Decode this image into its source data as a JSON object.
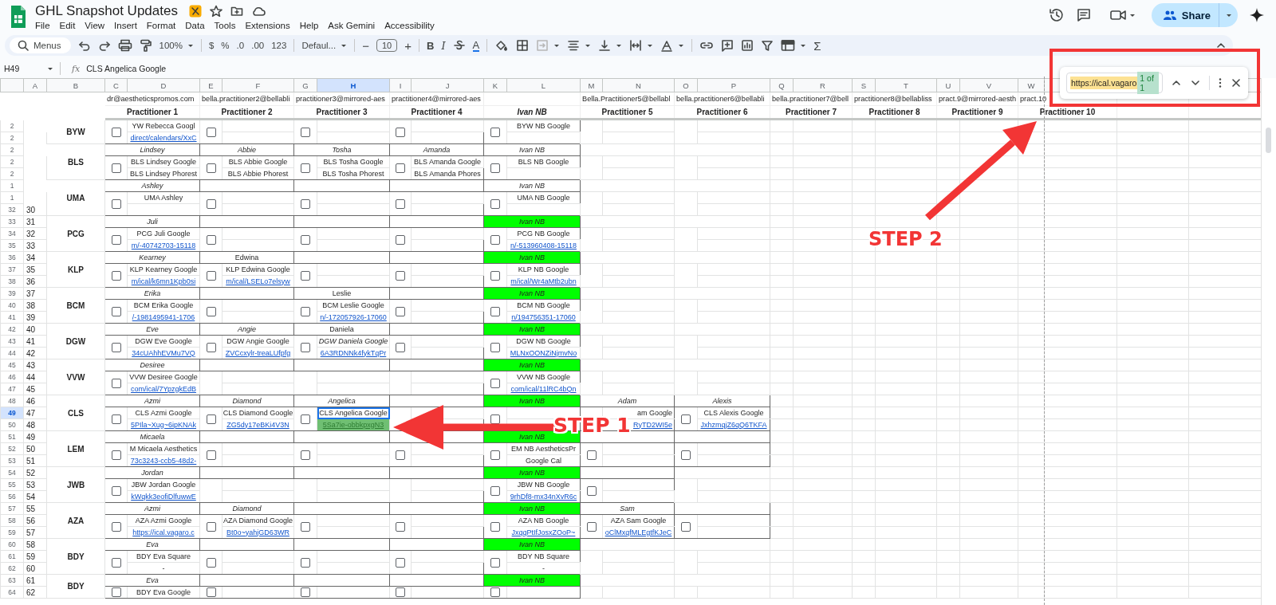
{
  "document": {
    "title": "GHL Snapshot Updates"
  },
  "menu": [
    "File",
    "Edit",
    "View",
    "Insert",
    "Format",
    "Data",
    "Tools",
    "Extensions",
    "Help",
    "Ask Gemini",
    "Accessibility"
  ],
  "share_button": "Share",
  "toolbar": {
    "search": "Menus",
    "zoom": "100%",
    "currency": "$",
    "percent": "%",
    "decrease_decimals": ".0",
    "increase_decimals": ".00",
    "number_format": "123",
    "font": "Defaul...",
    "minus": "−",
    "font_size": "10",
    "plus": "+",
    "bold": "B",
    "italic": "I",
    "text_color": "A",
    "functions": "Σ"
  },
  "formula_bar": {
    "name_box": "H49",
    "fx": "fx",
    "value": "CLS Angelica Google"
  },
  "find": {
    "query": "https://ical.vagaro",
    "count": "1 of 1"
  },
  "columns": [
    {
      "letter": "A",
      "selected": false
    },
    {
      "letter": "B",
      "selected": false
    },
    {
      "letter": "C",
      "selected": false
    },
    {
      "letter": "D",
      "selected": false
    },
    {
      "letter": "E",
      "selected": false
    },
    {
      "letter": "F",
      "selected": false
    },
    {
      "letter": "G",
      "selected": false
    },
    {
      "letter": "H",
      "selected": true
    },
    {
      "letter": "I",
      "selected": false
    },
    {
      "letter": "J",
      "selected": false
    },
    {
      "letter": "K",
      "selected": false
    },
    {
      "letter": "L",
      "selected": false
    },
    {
      "letter": "M",
      "selected": false
    },
    {
      "letter": "N",
      "selected": false
    },
    {
      "letter": "O",
      "selected": false
    },
    {
      "letter": "P",
      "selected": false
    },
    {
      "letter": "Q",
      "selected": false
    },
    {
      "letter": "R",
      "selected": false
    },
    {
      "letter": "S",
      "selected": false
    },
    {
      "letter": "T",
      "selected": false
    },
    {
      "letter": "U",
      "selected": false
    },
    {
      "letter": "V",
      "selected": false
    },
    {
      "letter": "W",
      "selected": false
    }
  ],
  "practitioner_columns": [
    {
      "email": "dr@aestheticspromos.com",
      "title": "Practitioner 1",
      "kind": "practitioner"
    },
    {
      "email": "bella.practitioner2@bellabli",
      "title": "Practitioner 2",
      "kind": "practitioner"
    },
    {
      "email": "practitioner3@mirrored-aes",
      "title": "Practitioner 3",
      "kind": "practitioner"
    },
    {
      "email": "practitioner4@mirrored-aes",
      "title": "Practitioner 4",
      "kind": "practitioner"
    },
    {
      "title": "Ivan NB",
      "kind": "house"
    },
    {
      "email": "Bella.Practitioner5@bellabl",
      "title": "Practitioner 5",
      "kind": "practitioner"
    },
    {
      "email": "bella.practitioner6@bellabli",
      "title": "Practitioner 6",
      "kind": "practitioner"
    },
    {
      "email": "bella.practitioner7@bell",
      "title": "Practitioner 7",
      "kind": "practitioner"
    },
    {
      "email": "practitioner8@bellabliss",
      "title": "Practitioner 8",
      "kind": "practitioner"
    },
    {
      "email": "pract.9@mirrored-aesth",
      "title": "Practitioner 9",
      "kind": "practitioner"
    },
    {
      "email": "pract.10",
      "title": "Practitioner 10",
      "kind": "practitioner"
    }
  ],
  "groups": [
    {
      "code": "BYW",
      "rows": [
        {
          "number": "2",
          "selected": false
        },
        {
          "number": "2",
          "selected": false
        }
      ],
      "slots": [
        {
          "kind": "assigned",
          "checkbox": {
            "checked": false
          },
          "lines": [
            {
              "text": "YW Rebecca Googl",
              "kind": "plain",
              "selected": false
            },
            {
              "text": "direct/calendars/XxC",
              "kind": "link",
              "selected": false
            }
          ]
        },
        {
          "kind": "vacant",
          "checkbox": {
            "checked": false
          }
        },
        {
          "kind": "vacant",
          "checkbox": {
            "checked": false
          }
        },
        {
          "kind": "vacant",
          "checkbox": {
            "checked": false
          }
        },
        {
          "kind": "assigned",
          "checkbox": {
            "checked": false
          },
          "lines": [
            {
              "text": "BYW NB Google",
              "kind": "plain",
              "selected": false
            }
          ]
        }
      ]
    },
    {
      "code": "BLS",
      "rows": [
        {
          "number": "2",
          "selected": false
        },
        {
          "number": "2",
          "selected": false
        },
        {
          "number": "2",
          "selected": false
        }
      ],
      "slots": [
        {
          "name": "Lindsey",
          "kind": "assigned",
          "highlighted": false,
          "checkbox": {
            "checked": false
          },
          "lines": [
            {
              "text": "BLS Lindsey Google",
              "kind": "plain",
              "selected": false
            },
            {
              "text": "BLS Lindsey Phorest",
              "kind": "plain",
              "selected": false
            }
          ]
        },
        {
          "name": "Abbie",
          "kind": "assigned",
          "highlighted": false,
          "checkbox": {
            "checked": false
          },
          "lines": [
            {
              "text": "BLS Abbie Google",
              "kind": "plain",
              "selected": false
            },
            {
              "text": "BLS Abbie Phorest",
              "kind": "plain",
              "selected": false
            }
          ]
        },
        {
          "name": "Tosha",
          "kind": "assigned",
          "highlighted": false,
          "checkbox": {
            "checked": false
          },
          "lines": [
            {
              "text": "BLS Tosha Google",
              "kind": "plain",
              "selected": false
            },
            {
              "text": "BLS Tosha Phorest",
              "kind": "plain",
              "selected": false
            }
          ]
        },
        {
          "name": "Amanda",
          "kind": "assigned",
          "highlighted": false,
          "checkbox": {
            "checked": false
          },
          "lines": [
            {
              "text": "BLS Amanda Google",
              "kind": "plain",
              "selected": false
            },
            {
              "text": "BLS Amanda Phores",
              "kind": "plain",
              "selected": false
            }
          ]
        },
        {
          "name": "Ivan NB",
          "kind": "assigned",
          "highlighted": false,
          "checkbox": {
            "checked": false
          },
          "lines": [
            {
              "text": "BLS NB Google",
              "kind": "plain",
              "selected": false
            }
          ]
        }
      ]
    },
    {
      "code": "UMA",
      "rows": [
        {
          "number": "1",
          "selected": false
        },
        {
          "number": "1",
          "selected": false
        },
        {
          "number": "32",
          "label": "30",
          "selected": false
        }
      ],
      "slots": [
        {
          "name": "Ashley",
          "kind": "assigned",
          "highlighted": false,
          "checkbox": {
            "checked": false
          },
          "lines": [
            {
              "text": "UMA Ashley",
              "kind": "plain",
              "selected": false
            }
          ]
        },
        {
          "kind": "vacant",
          "checkbox": {
            "checked": false
          }
        },
        {
          "kind": "vacant",
          "checkbox": {
            "checked": false
          }
        },
        {
          "kind": "vacant",
          "checkbox": {
            "checked": false
          }
        },
        {
          "name": "Ivan NB",
          "kind": "assigned",
          "highlighted": false,
          "checkbox": {
            "checked": false
          },
          "lines": [
            {
              "text": "UMA NB Google",
              "kind": "plain",
              "selected": false
            }
          ]
        }
      ]
    },
    {
      "code": "PCG",
      "rows": [
        {
          "number": "33",
          "label": "31",
          "selected": false
        },
        {
          "number": "34",
          "label": "32",
          "selected": false
        },
        {
          "number": "35",
          "label": "33",
          "selected": false
        }
      ],
      "slots": [
        {
          "name": "Juli",
          "kind": "assigned",
          "highlighted": false,
          "checkbox": {
            "checked": false
          },
          "lines": [
            {
              "text": "PCG Juli Google",
              "kind": "plain",
              "selected": false
            },
            {
              "text": "m/-40742703-15118",
              "kind": "link",
              "selected": false
            }
          ]
        },
        {
          "kind": "vacant",
          "checkbox": {
            "checked": false
          }
        },
        {
          "kind": "vacant",
          "checkbox": {
            "checked": false
          }
        },
        {
          "kind": "vacant",
          "checkbox": {
            "checked": false
          }
        },
        {
          "name": "Ivan NB",
          "kind": "assigned",
          "highlighted": true,
          "checkbox": {
            "checked": false
          },
          "lines": [
            {
              "text": "PCG NB Google",
              "kind": "plain",
              "selected": false
            },
            {
              "text": "n/-513960408-15118",
              "kind": "link",
              "selected": false
            }
          ]
        }
      ]
    },
    {
      "code": "KLP",
      "rows": [
        {
          "number": "36",
          "label": "34",
          "selected": false
        },
        {
          "number": "37",
          "label": "35",
          "selected": false
        },
        {
          "number": "38",
          "label": "36",
          "selected": false
        }
      ],
      "slots": [
        {
          "name": "Kearney",
          "kind": "assigned",
          "highlighted": false,
          "checkbox": {
            "checked": false
          },
          "lines": [
            {
              "text": "KLP Kearney Google",
              "kind": "plain",
              "selected": false
            },
            {
              "text": "m/ical/k6mn1Kpb0si",
              "kind": "link",
              "selected": false
            }
          ]
        },
        {
          "name": "Edwina",
          "kind": "added",
          "highlighted": false,
          "checkbox": {
            "checked": false
          },
          "lines": [
            {
              "text": "KLP Edwina Google",
              "kind": "plain",
              "selected": false
            },
            {
              "text": "m/ical/LSELo7elsyw",
              "kind": "link",
              "selected": false
            }
          ]
        },
        {
          "kind": "vacant",
          "checkbox": {
            "checked": false
          }
        },
        {
          "kind": "vacant",
          "checkbox": {
            "checked": false
          }
        },
        {
          "name": "Ivan NB",
          "kind": "assigned",
          "highlighted": true,
          "checkbox": {
            "checked": false
          },
          "lines": [
            {
              "text": "KLP NB Google",
              "kind": "plain",
              "selected": false
            },
            {
              "text": "m/ical/Wr4aMtb2ubn",
              "kind": "link",
              "selected": false
            }
          ]
        }
      ]
    },
    {
      "code": "BCM",
      "rows": [
        {
          "number": "39",
          "label": "37",
          "selected": false
        },
        {
          "number": "40",
          "label": "38",
          "selected": false
        },
        {
          "number": "41",
          "label": "39",
          "selected": false
        }
      ],
      "slots": [
        {
          "name": "Erika",
          "kind": "assigned",
          "highlighted": false,
          "checkbox": {
            "checked": false
          },
          "lines": [
            {
              "text": "BCM Erika Google",
              "kind": "plain",
              "selected": false
            },
            {
              "text": "/-1981495941-1706",
              "kind": "link",
              "selected": false
            }
          ]
        },
        {
          "kind": "vacant",
          "checkbox": {
            "checked": false
          }
        },
        {
          "name": "Leslie",
          "kind": "added",
          "highlighted": false,
          "checkbox": {
            "checked": false
          },
          "lines": [
            {
              "text": "BCM Leslie Google",
              "kind": "plain",
              "selected": false
            },
            {
              "text": "n/-172057926-17060",
              "kind": "link",
              "selected": false
            }
          ]
        },
        {
          "kind": "vacant",
          "checkbox": {
            "checked": false
          }
        },
        {
          "name": "Ivan NB",
          "kind": "assigned",
          "highlighted": true,
          "checkbox": {
            "checked": false
          },
          "lines": [
            {
              "text": "BCM NB Google",
              "kind": "plain",
              "selected": false
            },
            {
              "text": "n/194756351-17060",
              "kind": "link",
              "selected": false
            }
          ]
        }
      ]
    },
    {
      "code": "DGW",
      "rows": [
        {
          "number": "42",
          "label": "40",
          "selected": false
        },
        {
          "number": "43",
          "label": "41",
          "selected": false
        },
        {
          "number": "44",
          "label": "42",
          "selected": false
        }
      ],
      "slots": [
        {
          "name": "Eve",
          "kind": "assigned",
          "highlighted": false,
          "checkbox": {
            "checked": false
          },
          "lines": [
            {
              "text": "DGW Eve Google",
              "kind": "plain",
              "selected": false
            },
            {
              "text": "34cUAhhEVMu7VQ",
              "kind": "link",
              "selected": false
            }
          ]
        },
        {
          "name": "Angie",
          "kind": "assigned",
          "highlighted": false,
          "checkbox": {
            "checked": false
          },
          "lines": [
            {
              "text": "DGW Angie Google",
              "kind": "plain",
              "selected": false
            },
            {
              "text": "ZVCcxylr-treaLUfpfg",
              "kind": "link",
              "selected": false
            }
          ]
        },
        {
          "name": "Daniela",
          "kind": "added",
          "highlighted": false,
          "checkbox": {
            "checked": false
          },
          "lines": [
            {
              "text": "DGW Daniela Google",
              "kind": "italic",
              "selected": false
            },
            {
              "text": "6A3RDNNk4fykTqPr",
              "kind": "link",
              "selected": false
            }
          ]
        },
        {
          "kind": "vacant",
          "checkbox": {
            "checked": false
          }
        },
        {
          "name": "Ivan NB",
          "kind": "assigned",
          "highlighted": true,
          "checkbox": {
            "checked": false
          },
          "lines": [
            {
              "text": "DGW NB Google",
              "kind": "plain",
              "selected": false
            },
            {
              "text": "MLNxOONZiNjmvNo",
              "kind": "link",
              "selected": false
            }
          ]
        }
      ]
    },
    {
      "code": "VVW",
      "rows": [
        {
          "number": "45",
          "label": "43",
          "selected": false
        },
        {
          "number": "46",
          "label": "44",
          "selected": false
        },
        {
          "number": "47",
          "label": "45",
          "selected": false
        }
      ],
      "slots": [
        {
          "name": "Desiree",
          "kind": "assigned",
          "highlighted": false,
          "checkbox": {
            "checked": false
          },
          "lines": [
            {
              "text": "VVW Desiree Google",
              "kind": "plain",
              "selected": false
            },
            {
              "text": "com/ical/7YpzgkEdB",
              "kind": "link",
              "selected": false
            }
          ]
        },
        {
          "kind": "vacant"
        },
        {
          "kind": "vacant"
        },
        {
          "kind": "vacant"
        },
        {
          "name": "Ivan NB",
          "kind": "assigned",
          "highlighted": true,
          "checkbox": {
            "checked": false
          },
          "lines": [
            {
              "text": "VVW NB Google",
              "kind": "plain",
              "selected": false
            },
            {
              "text": "com/ical/11lRC4bQn",
              "kind": "link",
              "selected": false
            }
          ]
        }
      ]
    },
    {
      "code": "CLS",
      "rows": [
        {
          "number": "48",
          "label": "46",
          "selected": false
        },
        {
          "number": "49",
          "label": "47",
          "selected": true
        },
        {
          "number": "50",
          "label": "48",
          "selected": false
        }
      ],
      "slots": [
        {
          "name": "Azmi",
          "kind": "assigned",
          "highlighted": false,
          "checkbox": {
            "checked": false
          },
          "lines": [
            {
              "text": "CLS Azmi Google",
              "kind": "plain",
              "selected": false
            },
            {
              "text": "5PIla~Xug~6ipKNAk",
              "kind": "link",
              "selected": false
            }
          ]
        },
        {
          "name": "Diamond",
          "kind": "assigned",
          "highlighted": false,
          "checkbox": {
            "checked": false
          },
          "lines": [
            {
              "text": "CLS Diamond Google",
              "kind": "plain",
              "selected": false
            },
            {
              "text": "ZG5dy17eBKi4V3N",
              "kind": "link",
              "selected": false
            }
          ]
        },
        {
          "name": "Angelica",
          "kind": "assigned",
          "highlighted": false,
          "checkbox": {
            "checked": false
          },
          "lines": [
            {
              "text": "CLS Angelica Google",
              "kind": "plain",
              "selected": true
            },
            {
              "text": "5Sa7ie-obbkpxgN3",
              "kind": "found",
              "selected": false
            }
          ]
        },
        {
          "kind": "vacant"
        },
        {
          "name": "Ivan NB",
          "kind": "assigned",
          "highlighted": true,
          "checkbox": {
            "checked": false
          }
        },
        {
          "name": "Adam",
          "kind": "assigned",
          "highlighted": false,
          "lines": [
            {
              "text": "am Google",
              "kind": "clipped",
              "selected": false
            },
            {
              "text": "RyTD2WI5e",
              "kind": "clipped-link",
              "selected": false
            }
          ]
        },
        {
          "name": "Alexis",
          "kind": "assigned",
          "highlighted": false,
          "checkbox": {
            "checked": false
          },
          "lines": [
            {
              "text": "CLS Alexis Google",
              "kind": "plain",
              "selected": false
            },
            {
              "text": "JxhzmqjZ6qQ6TKFA",
              "kind": "link",
              "selected": false
            }
          ]
        }
      ]
    },
    {
      "code": "LEM",
      "rows": [
        {
          "number": "51",
          "label": "49",
          "selected": false
        },
        {
          "number": "52",
          "label": "50",
          "selected": false
        },
        {
          "number": "53",
          "label": "51",
          "selected": false
        }
      ],
      "slots": [
        {
          "name": "Micaela",
          "kind": "assigned",
          "highlighted": false,
          "checkbox": {
            "checked": false
          },
          "lines": [
            {
              "text": "M Micaela Aesthetics",
              "kind": "plain",
              "selected": false
            },
            {
              "text": "73c3243-ccb5-48d2-",
              "kind": "link",
              "selected": false
            }
          ]
        },
        {
          "kind": "vacant",
          "checkbox": {
            "checked": false
          }
        },
        {
          "kind": "vacant",
          "checkbox": {
            "checked": false
          }
        },
        {
          "kind": "vacant",
          "checkbox": {
            "checked": false
          }
        },
        {
          "name": "Ivan NB",
          "kind": "assigned",
          "highlighted": true,
          "checkbox": {
            "checked": false
          },
          "lines": [
            {
              "text": "EM NB AestheticsPr",
              "kind": "plain",
              "selected": false
            },
            {
              "text": "Google Cal",
              "kind": "plain",
              "selected": false
            }
          ]
        },
        {
          "kind": "vacant",
          "checkbox": {
            "checked": false
          }
        },
        {
          "kind": "vacant",
          "checkbox": {
            "checked": false
          }
        }
      ]
    },
    {
      "code": "JWB",
      "rows": [
        {
          "number": "54",
          "label": "52",
          "selected": false
        },
        {
          "number": "55",
          "label": "53",
          "selected": false
        },
        {
          "number": "56",
          "label": "54",
          "selected": false
        }
      ],
      "slots": [
        {
          "name": "Jordan",
          "kind": "assigned",
          "highlighted": false,
          "checkbox": {
            "checked": false
          },
          "lines": [
            {
              "text": "JBW Jordan Google",
              "kind": "plain",
              "selected": false
            },
            {
              "text": "kWqkk3eofiDlfuwwE",
              "kind": "link",
              "selected": false
            }
          ]
        },
        {
          "kind": "vacant"
        },
        {
          "kind": "vacant"
        },
        {
          "kind": "vacant"
        },
        {
          "name": "Ivan NB",
          "kind": "assigned",
          "highlighted": true,
          "checkbox": {
            "checked": false
          },
          "lines": [
            {
              "text": "JBW NB Google",
              "kind": "plain",
              "selected": false
            },
            {
              "text": "9rhDf8-mx34nXvR6c",
              "kind": "link",
              "selected": false
            }
          ]
        },
        {
          "kind": "vacant",
          "checkbox": {
            "checked": false
          }
        }
      ]
    },
    {
      "code": "AZA",
      "rows": [
        {
          "number": "57",
          "label": "55",
          "selected": false
        },
        {
          "number": "58",
          "label": "56",
          "selected": false
        },
        {
          "number": "59",
          "label": "57",
          "selected": false
        }
      ],
      "slots": [
        {
          "name": "Azmi",
          "kind": "assigned",
          "highlighted": false,
          "checkbox": {
            "checked": false
          },
          "lines": [
            {
              "text": "AZA Azmi Google",
              "kind": "plain",
              "selected": false
            },
            {
              "text": "https://ical.vagaro.c",
              "kind": "link",
              "selected": false
            }
          ]
        },
        {
          "name": "Diamond",
          "kind": "assigned",
          "highlighted": false,
          "checkbox": {
            "checked": false
          },
          "lines": [
            {
              "text": "AZA Diamond Google",
              "kind": "plain",
              "selected": false
            },
            {
              "text": "Bt0o~yahjGD63WR",
              "kind": "link",
              "selected": false
            }
          ]
        },
        {
          "kind": "vacant",
          "checkbox": {
            "checked": false
          }
        },
        {
          "kind": "vacant",
          "checkbox": {
            "checked": false
          }
        },
        {
          "name": "Ivan NB",
          "kind": "assigned",
          "highlighted": true,
          "checkbox": {
            "checked": false
          },
          "lines": [
            {
              "text": "AZA NB Google",
              "kind": "plain",
              "selected": false
            },
            {
              "text": "JxqqPtIfJosxZOoP~",
              "kind": "link",
              "selected": false
            }
          ]
        },
        {
          "name": "Sam",
          "kind": "assigned",
          "highlighted": false,
          "checkbox": {
            "checked": false
          },
          "lines": [
            {
              "text": "AZA Sam Google",
              "kind": "plain",
              "selected": false
            },
            {
              "text": "oClMxqfMLEgtfKJeC",
              "kind": "link",
              "selected": false
            }
          ]
        },
        {
          "kind": "vacant",
          "checkbox": {
            "checked": false
          }
        }
      ]
    },
    {
      "code": "BDY",
      "rows": [
        {
          "number": "60",
          "label": "58",
          "selected": false
        },
        {
          "number": "61",
          "label": "59",
          "selected": false
        },
        {
          "number": "62",
          "label": "60",
          "selected": false
        }
      ],
      "slots": [
        {
          "name": "Eva",
          "kind": "assigned",
          "highlighted": false,
          "checkbox": {
            "checked": false
          },
          "lines": [
            {
              "text": "BDY Eva Square",
              "kind": "plain",
              "selected": false
            },
            {
              "text": "-",
              "kind": "plain",
              "selected": false
            }
          ]
        },
        {
          "kind": "vacant",
          "checkbox": {
            "checked": false
          }
        },
        {
          "kind": "vacant",
          "checkbox": {
            "checked": false
          }
        },
        {
          "kind": "vacant",
          "checkbox": {
            "checked": false
          }
        },
        {
          "name": "Ivan NB",
          "kind": "assigned",
          "highlighted": true,
          "checkbox": {
            "checked": false
          },
          "lines": [
            {
              "text": "BDY NB Square",
              "kind": "plain",
              "selected": false
            },
            {
              "text": "-",
              "kind": "plain",
              "selected": false
            }
          ]
        }
      ]
    },
    {
      "code": "BDY",
      "rows": [
        {
          "number": "63",
          "label": "61",
          "selected": false
        },
        {
          "number": "64",
          "label": "62",
          "selected": false
        }
      ],
      "slots": [
        {
          "name": "Eva",
          "kind": "assigned",
          "highlighted": false,
          "checkbox": {
            "checked": false
          },
          "lines": [
            {
              "text": "BDY Eva Google",
              "kind": "plain",
              "selected": false
            }
          ]
        },
        {
          "kind": "vacant",
          "checkbox": {
            "checked": false
          }
        },
        {
          "kind": "vacant",
          "checkbox": {
            "checked": false
          }
        },
        {
          "kind": "vacant",
          "checkbox": {
            "checked": false
          }
        },
        {
          "name": "Ivan NB",
          "kind": "assigned",
          "highlighted": true,
          "checkbox": {
            "checked": false
          }
        }
      ]
    }
  ],
  "annotations": [
    {
      "kind": "arrow-label",
      "text": "STEP 2"
    },
    {
      "kind": "arrow-label",
      "text": "STEP 1"
    }
  ]
}
